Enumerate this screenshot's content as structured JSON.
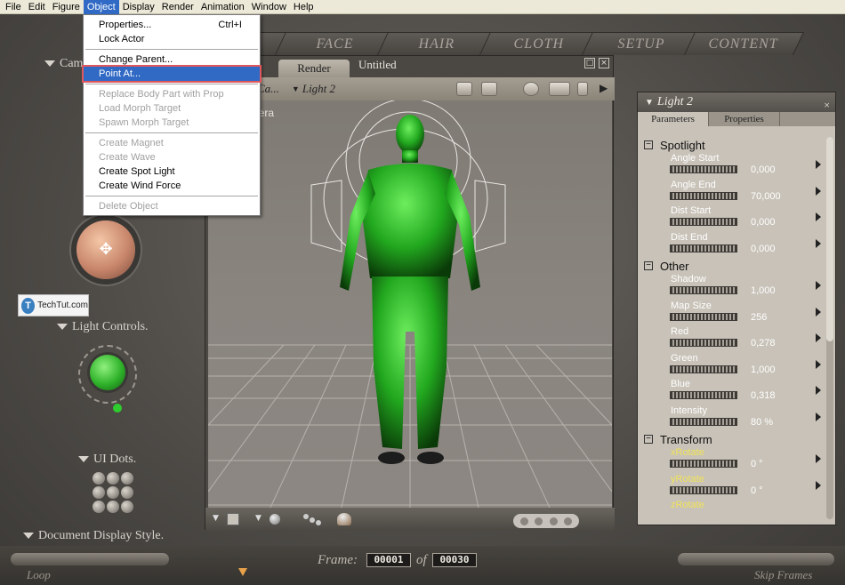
{
  "menubar": {
    "items": [
      "File",
      "Edit",
      "Figure",
      "Object",
      "Display",
      "Render",
      "Animation",
      "Window",
      "Help"
    ],
    "active": "Object"
  },
  "object_menu": {
    "properties": "Properties...",
    "properties_shortcut": "Ctrl+I",
    "lock_actor": "Lock Actor",
    "change_parent": "Change Parent...",
    "point_at": "Point At...",
    "replace_body_part": "Replace Body Part with Prop",
    "load_morph_target": "Load Morph Target",
    "spawn_morph_target": "Spawn Morph Target",
    "create_magnet": "Create Magnet",
    "create_wave": "Create Wave",
    "create_spot_light": "Create Spot Light",
    "create_wind_force": "Create Wind Force",
    "delete_object": "Delete Object"
  },
  "room_tabs": [
    "L",
    "FACE",
    "HAIR",
    "CLOTH",
    "SETUP",
    "CONTENT"
  ],
  "left_panel": {
    "camera_label": "Cam",
    "light_controls": "Light Controls.",
    "ui_dots": "UI Dots.",
    "document_display_style": "Document Display Style.",
    "watermark": "TechTut.com",
    "watermark_icon": "T"
  },
  "document": {
    "render_tab": "Render",
    "title": "Untitled",
    "camera_select": "Ca...",
    "light_select": "Light 2",
    "viewport_label": "nera"
  },
  "parameters": {
    "title": "Light 2",
    "tabs": [
      "Parameters",
      "Properties"
    ],
    "groups": {
      "spotlight": "Spotlight",
      "other": "Other",
      "transform": "Transform"
    },
    "spotlight_params": [
      {
        "name": "Angle Start",
        "value": "0,000"
      },
      {
        "name": "Angle End",
        "value": "70,000"
      },
      {
        "name": "Dist Start",
        "value": "0,000"
      },
      {
        "name": "Dist End",
        "value": "0,000"
      }
    ],
    "other_params": [
      {
        "name": "Shadow",
        "value": "1,000"
      },
      {
        "name": "Map Size",
        "value": "256"
      },
      {
        "name": "Red",
        "value": "0,278"
      },
      {
        "name": "Green",
        "value": "1,000"
      },
      {
        "name": "Blue",
        "value": "0,318"
      },
      {
        "name": "Intensity",
        "value": "80 %"
      }
    ],
    "transform_params": [
      {
        "name": "xRotate",
        "value": "0 °"
      },
      {
        "name": "yRotate",
        "value": "0 °"
      },
      {
        "name": "zRotate",
        "value": ""
      }
    ]
  },
  "bottom_bar": {
    "frame_label": "Frame:",
    "current_frame": "00001",
    "of_label": "of",
    "total_frames": "00030",
    "loop_label": "Loop",
    "skip_frames_label": "Skip Frames"
  },
  "colors": {
    "menu_highlight": "#316ac5",
    "highlight_outline": "#e0585e",
    "figure_green": "#2fb22a",
    "panel_bg": "#c8c2b8"
  }
}
